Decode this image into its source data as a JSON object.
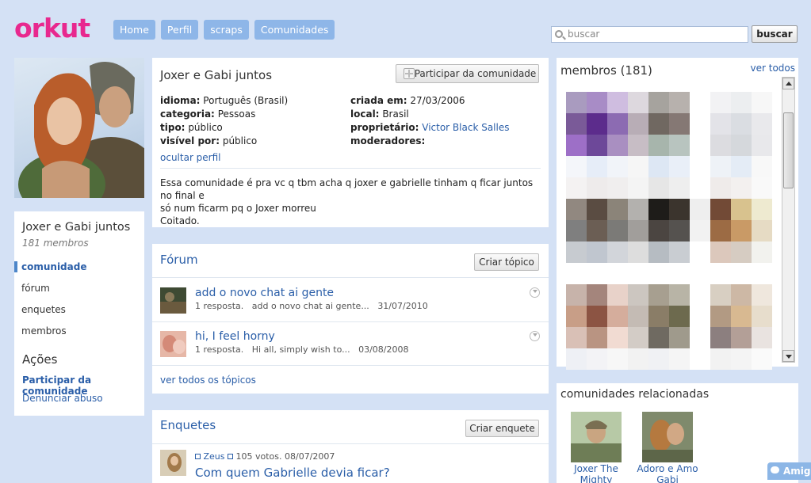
{
  "header": {
    "logo": "orkut",
    "nav": [
      "Home",
      "Perfil",
      "scraps",
      "Comunidades"
    ],
    "search_placeholder": "buscar",
    "search_button": "buscar"
  },
  "left": {
    "community_name": "Joxer e Gabi juntos",
    "member_count": "181 membros",
    "menu": [
      "comunidade",
      "fórum",
      "enquetes",
      "membros"
    ],
    "actions_title": "Ações",
    "actions": [
      "Participar da comunidade",
      "Denunciar abuso"
    ]
  },
  "info": {
    "title": "Joxer e Gabi juntos",
    "join_button": "Participar da comunidade",
    "fields": {
      "idioma_label": "idioma:",
      "idioma": "Português (Brasil)",
      "categoria_label": "categoria:",
      "categoria": "Pessoas",
      "tipo_label": "tipo:",
      "tipo": "público",
      "visivel_label": "visível por:",
      "visivel": "público",
      "criada_label": "criada em:",
      "criada": "27/03/2006",
      "local_label": "local:",
      "local": "Brasil",
      "proprietario_label": "proprietário:",
      "proprietario": "Victor Black Salles",
      "moderadores_label": "moderadores:"
    },
    "hide_link": "ocultar perfil",
    "description_1": "Essa comunidade é pra vc q tbm acha q joxer e gabrielle tinham q ficar juntos no final e",
    "description_2": "só num ficarm pq o Joxer morreu",
    "description_3": "Coitado."
  },
  "forum": {
    "title": "Fórum",
    "create_button": "Criar tópico",
    "topics": [
      {
        "title": "add o novo chat ai gente",
        "meta": "1 resposta.",
        "snippet": "add o novo chat ai gente...",
        "date": "31/07/2010"
      },
      {
        "title": "hi, I feel horny",
        "meta": "1 resposta.",
        "snippet": "Hi all, simply wish to...",
        "date": "03/08/2008"
      }
    ],
    "see_all": "ver todos os tópicos"
  },
  "polls": {
    "title": "Enquetes",
    "create_button": "Criar enquete",
    "author": "Zeus",
    "stats": "105 votos. 08/07/2007",
    "question": "Com quem Gabrielle devia ficar?"
  },
  "members": {
    "title": "membros (181)",
    "see_all": "ver todos"
  },
  "related": {
    "title": "comunidades relacionadas",
    "items": [
      "Joxer The Mighty",
      "Adoro e Amo Gabi"
    ]
  },
  "chat": {
    "label": "Amigos"
  },
  "colors": {
    "brand": "#e8288e",
    "link": "#2a5ea8",
    "nav": "#8eb6e8",
    "background": "#d4e1f5"
  }
}
